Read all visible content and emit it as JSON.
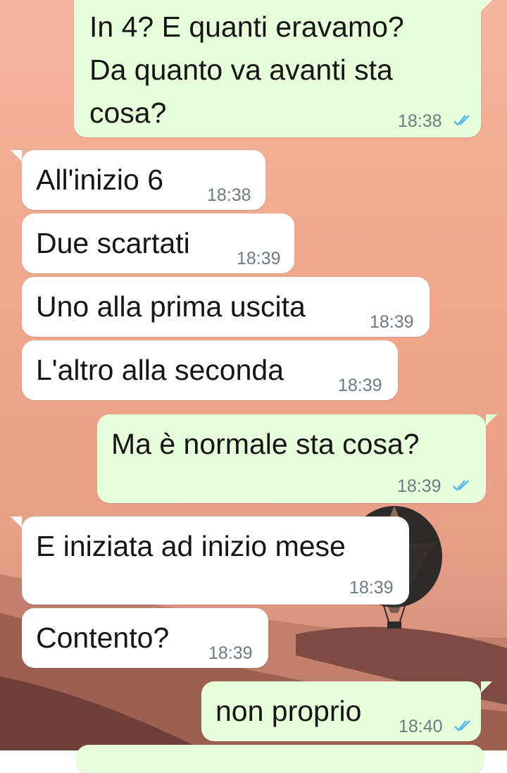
{
  "colors": {
    "incoming_bubble": "#ffffff",
    "outgoing_bubble": "#e7ffdb",
    "read_ticks": "#4fb6ec",
    "timestamp": "#6d7a80"
  },
  "chat": {
    "messages": [
      {
        "direction": "outgoing",
        "text": "In 4? E quanti eravamo?\nDa quanto va avanti sta\ncosa?",
        "time": "18:38",
        "status": "read"
      },
      {
        "direction": "incoming",
        "text": "All'inizio 6",
        "time": "18:38"
      },
      {
        "direction": "incoming",
        "text": "Due scartati",
        "time": "18:39"
      },
      {
        "direction": "incoming",
        "text": "Uno alla prima uscita",
        "time": "18:39"
      },
      {
        "direction": "incoming",
        "text": "L'altro alla seconda",
        "time": "18:39"
      },
      {
        "direction": "outgoing",
        "text": "Ma è normale sta cosa?",
        "time": "18:39",
        "status": "read"
      },
      {
        "direction": "incoming",
        "text": "E iniziata ad inizio mese",
        "time": "18:39"
      },
      {
        "direction": "incoming",
        "text": "Contento?",
        "time": "18:39"
      },
      {
        "direction": "outgoing",
        "text": "non proprio",
        "time": "18:40",
        "status": "read"
      }
    ]
  }
}
